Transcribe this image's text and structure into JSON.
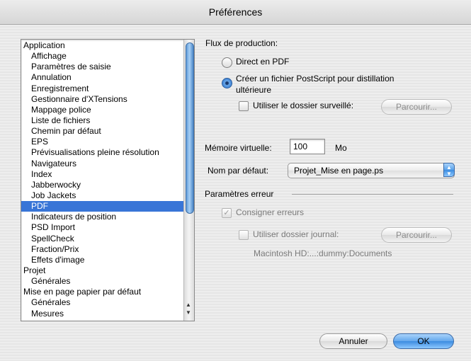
{
  "window": {
    "title": "Préférences"
  },
  "list": {
    "items": [
      {
        "label": "Application",
        "indent": false,
        "selected": false
      },
      {
        "label": "Affichage",
        "indent": true,
        "selected": false
      },
      {
        "label": "Paramètres de saisie",
        "indent": true,
        "selected": false
      },
      {
        "label": "Annulation",
        "indent": true,
        "selected": false
      },
      {
        "label": "Enregistrement",
        "indent": true,
        "selected": false
      },
      {
        "label": "Gestionnaire d'XTensions",
        "indent": true,
        "selected": false
      },
      {
        "label": "Mappage police",
        "indent": true,
        "selected": false
      },
      {
        "label": "Liste de fichiers",
        "indent": true,
        "selected": false
      },
      {
        "label": "Chemin par défaut",
        "indent": true,
        "selected": false
      },
      {
        "label": "EPS",
        "indent": true,
        "selected": false
      },
      {
        "label": "Prévisualisations pleine résolution",
        "indent": true,
        "selected": false
      },
      {
        "label": "Navigateurs",
        "indent": true,
        "selected": false
      },
      {
        "label": "Index",
        "indent": true,
        "selected": false
      },
      {
        "label": "Jabberwocky",
        "indent": true,
        "selected": false
      },
      {
        "label": "Job Jackets",
        "indent": true,
        "selected": false
      },
      {
        "label": "PDF",
        "indent": true,
        "selected": true
      },
      {
        "label": "Indicateurs de position",
        "indent": true,
        "selected": false
      },
      {
        "label": "PSD Import",
        "indent": true,
        "selected": false
      },
      {
        "label": "SpellCheck",
        "indent": true,
        "selected": false
      },
      {
        "label": "Fraction/Prix",
        "indent": true,
        "selected": false
      },
      {
        "label": "Effets d'image",
        "indent": true,
        "selected": false
      },
      {
        "label": "Projet",
        "indent": false,
        "selected": false
      },
      {
        "label": "Générales",
        "indent": true,
        "selected": false
      },
      {
        "label": "Mise en page papier par défaut",
        "indent": false,
        "selected": false
      },
      {
        "label": "Générales",
        "indent": true,
        "selected": false
      },
      {
        "label": "Mesures",
        "indent": true,
        "selected": false
      }
    ]
  },
  "workflow": {
    "heading": "Flux de production:",
    "direct_label": "Direct en PDF",
    "postscript_label_line1": "Créer un fichier PostScript pour distillation",
    "postscript_label_line2": "ultérieure",
    "watched_folder_label": "Utiliser le dossier surveillé:",
    "browse_label": "Parcourir..."
  },
  "memory": {
    "label": "Mémoire virtuelle:",
    "value": "100",
    "unit": "Mo"
  },
  "default_name": {
    "label": "Nom par défaut:",
    "value": "Projet_Mise en page.ps"
  },
  "errors": {
    "heading": "Paramètres erreur",
    "log_label": "Consigner erreurs",
    "log_checked": true,
    "log_folder_label": "Utiliser dossier journal:",
    "browse_label": "Parcourir...",
    "path": "Macintosh HD:...:dummy:Documents"
  },
  "buttons": {
    "cancel": "Annuler",
    "ok": "OK"
  },
  "colors": {
    "selection": "#3875d7",
    "accent": "#3c8ce0"
  }
}
